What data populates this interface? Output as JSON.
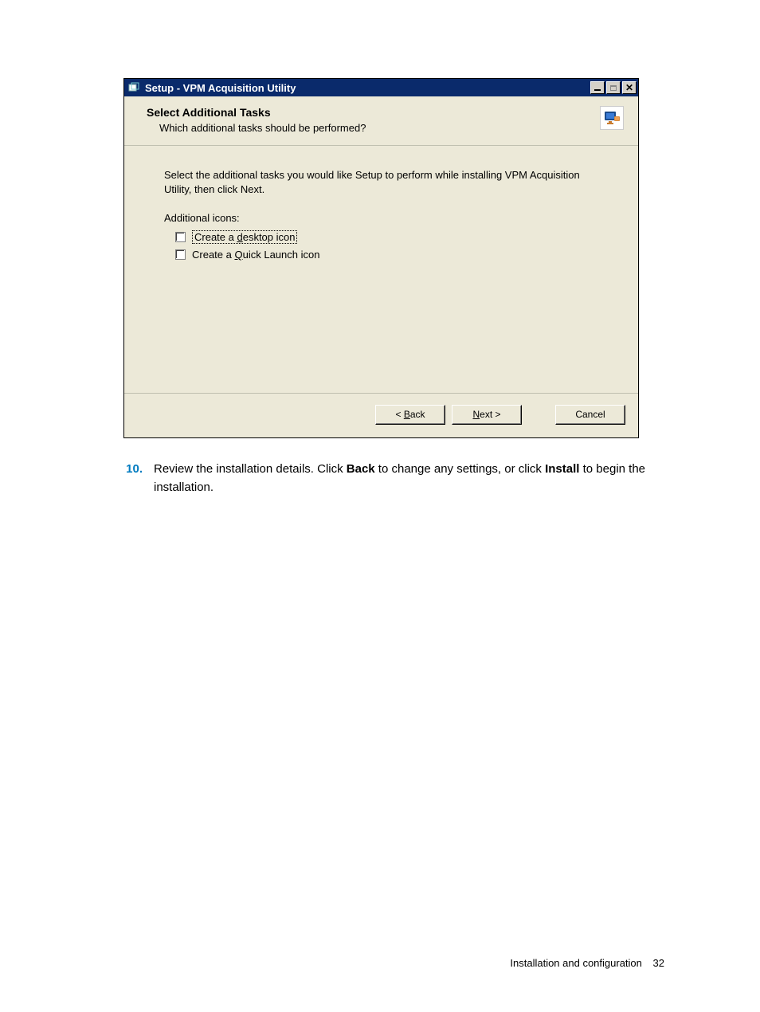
{
  "dialog": {
    "title": "Setup - VPM Acquisition Utility",
    "header": {
      "title": "Select Additional Tasks",
      "subtitle": "Which additional tasks should be performed?"
    },
    "body": {
      "instruction": "Select the additional tasks you would like Setup to perform while installing VPM Acquisition Utility, then click Next.",
      "group_label": "Additional icons:",
      "options": [
        {
          "pre": "Create a ",
          "hot": "d",
          "post": "esktop icon"
        },
        {
          "pre": "Create a ",
          "hot": "Q",
          "post": "uick Launch icon"
        }
      ]
    },
    "buttons": {
      "back": {
        "lt": "< ",
        "hot": "B",
        "post": "ack"
      },
      "next": {
        "hot": "N",
        "post": "ext >"
      },
      "cancel": "Cancel"
    }
  },
  "step": {
    "number": "10.",
    "t1": "Review the installation details. Click ",
    "b1": "Back",
    "t2": " to change any settings, or click ",
    "b2": "Install",
    "t3": " to begin the installation."
  },
  "footer": {
    "section": "Installation and configuration",
    "page": "32"
  }
}
